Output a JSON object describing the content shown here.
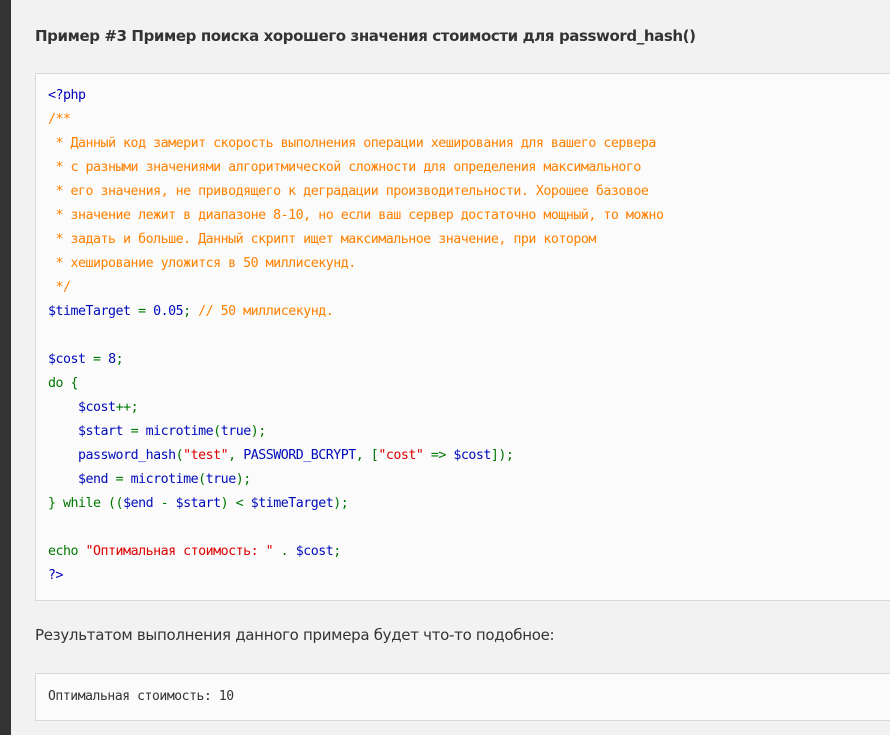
{
  "example": {
    "title": "Пример #3 Пример поиска хорошего значения стоимости для password_hash()"
  },
  "code": {
    "lines": [
      [
        {
          "t": "<?php",
          "c": "def"
        }
      ],
      [
        {
          "t": "/**",
          "c": "com"
        }
      ],
      [
        {
          "t": " * Данный код замерит скорость выполнения операции хеширования для вашего сервера",
          "c": "com"
        }
      ],
      [
        {
          "t": " * с разными значениями алгоритмической сложности для определения максимального",
          "c": "com"
        }
      ],
      [
        {
          "t": " * его значения, не приводящего к деградации производительности. Хорошее базовое",
          "c": "com"
        }
      ],
      [
        {
          "t": " * значение лежит в диапазоне 8-10, но если ваш сервер достаточно мощный, то можно",
          "c": "com"
        }
      ],
      [
        {
          "t": " * задать и больше. Данный скрипт ищет максимальное значение, при котором",
          "c": "com"
        }
      ],
      [
        {
          "t": " * хеширование уложится в 50 миллисекунд.",
          "c": "com"
        }
      ],
      [
        {
          "t": " */",
          "c": "com"
        }
      ],
      [
        {
          "t": "$timeTarget",
          "c": "var"
        },
        {
          "t": " = ",
          "c": "kw"
        },
        {
          "t": "0.05",
          "c": "var"
        },
        {
          "t": "; ",
          "c": "kw"
        },
        {
          "t": "// 50 миллисекунд.",
          "c": "com"
        }
      ],
      [],
      [
        {
          "t": "$cost",
          "c": "var"
        },
        {
          "t": " = ",
          "c": "kw"
        },
        {
          "t": "8",
          "c": "var"
        },
        {
          "t": ";",
          "c": "kw"
        }
      ],
      [
        {
          "t": "do {",
          "c": "kw"
        }
      ],
      [
        {
          "t": "    ",
          "c": "kw"
        },
        {
          "t": "$cost",
          "c": "var"
        },
        {
          "t": "++;",
          "c": "kw"
        }
      ],
      [
        {
          "t": "    ",
          "c": "kw"
        },
        {
          "t": "$start",
          "c": "var"
        },
        {
          "t": " = ",
          "c": "kw"
        },
        {
          "t": "microtime",
          "c": "var"
        },
        {
          "t": "(",
          "c": "kw"
        },
        {
          "t": "true",
          "c": "var"
        },
        {
          "t": ");",
          "c": "kw"
        }
      ],
      [
        {
          "t": "    ",
          "c": "kw"
        },
        {
          "t": "password_hash",
          "c": "var"
        },
        {
          "t": "(",
          "c": "kw"
        },
        {
          "t": "\"test\"",
          "c": "str"
        },
        {
          "t": ", ",
          "c": "kw"
        },
        {
          "t": "PASSWORD_BCRYPT",
          "c": "var"
        },
        {
          "t": ", [",
          "c": "kw"
        },
        {
          "t": "\"cost\"",
          "c": "str"
        },
        {
          "t": " => ",
          "c": "kw"
        },
        {
          "t": "$cost",
          "c": "var"
        },
        {
          "t": "]);",
          "c": "kw"
        }
      ],
      [
        {
          "t": "    ",
          "c": "kw"
        },
        {
          "t": "$end",
          "c": "var"
        },
        {
          "t": " = ",
          "c": "kw"
        },
        {
          "t": "microtime",
          "c": "var"
        },
        {
          "t": "(",
          "c": "kw"
        },
        {
          "t": "true",
          "c": "var"
        },
        {
          "t": ");",
          "c": "kw"
        }
      ],
      [
        {
          "t": "} while ((",
          "c": "kw"
        },
        {
          "t": "$end",
          "c": "var"
        },
        {
          "t": " - ",
          "c": "kw"
        },
        {
          "t": "$start",
          "c": "var"
        },
        {
          "t": ") < ",
          "c": "kw"
        },
        {
          "t": "$timeTarget",
          "c": "var"
        },
        {
          "t": ");",
          "c": "kw"
        }
      ],
      [],
      [
        {
          "t": "echo ",
          "c": "kw"
        },
        {
          "t": "\"Оптимальная стоимость: \"",
          "c": "str"
        },
        {
          "t": " . ",
          "c": "kw"
        },
        {
          "t": "$cost",
          "c": "var"
        },
        {
          "t": ";",
          "c": "kw"
        }
      ],
      [
        {
          "t": "?>",
          "c": "def"
        }
      ]
    ]
  },
  "result": {
    "intro": "Результатом выполнения данного примера будет что-то подобное:",
    "output": "Оптимальная стоимость: 10"
  },
  "colors": {
    "keyword": "#007700",
    "variable": "#000bbb",
    "string": "#dd0000",
    "comment": "#ff8000",
    "php_tag": "#0000bb"
  }
}
